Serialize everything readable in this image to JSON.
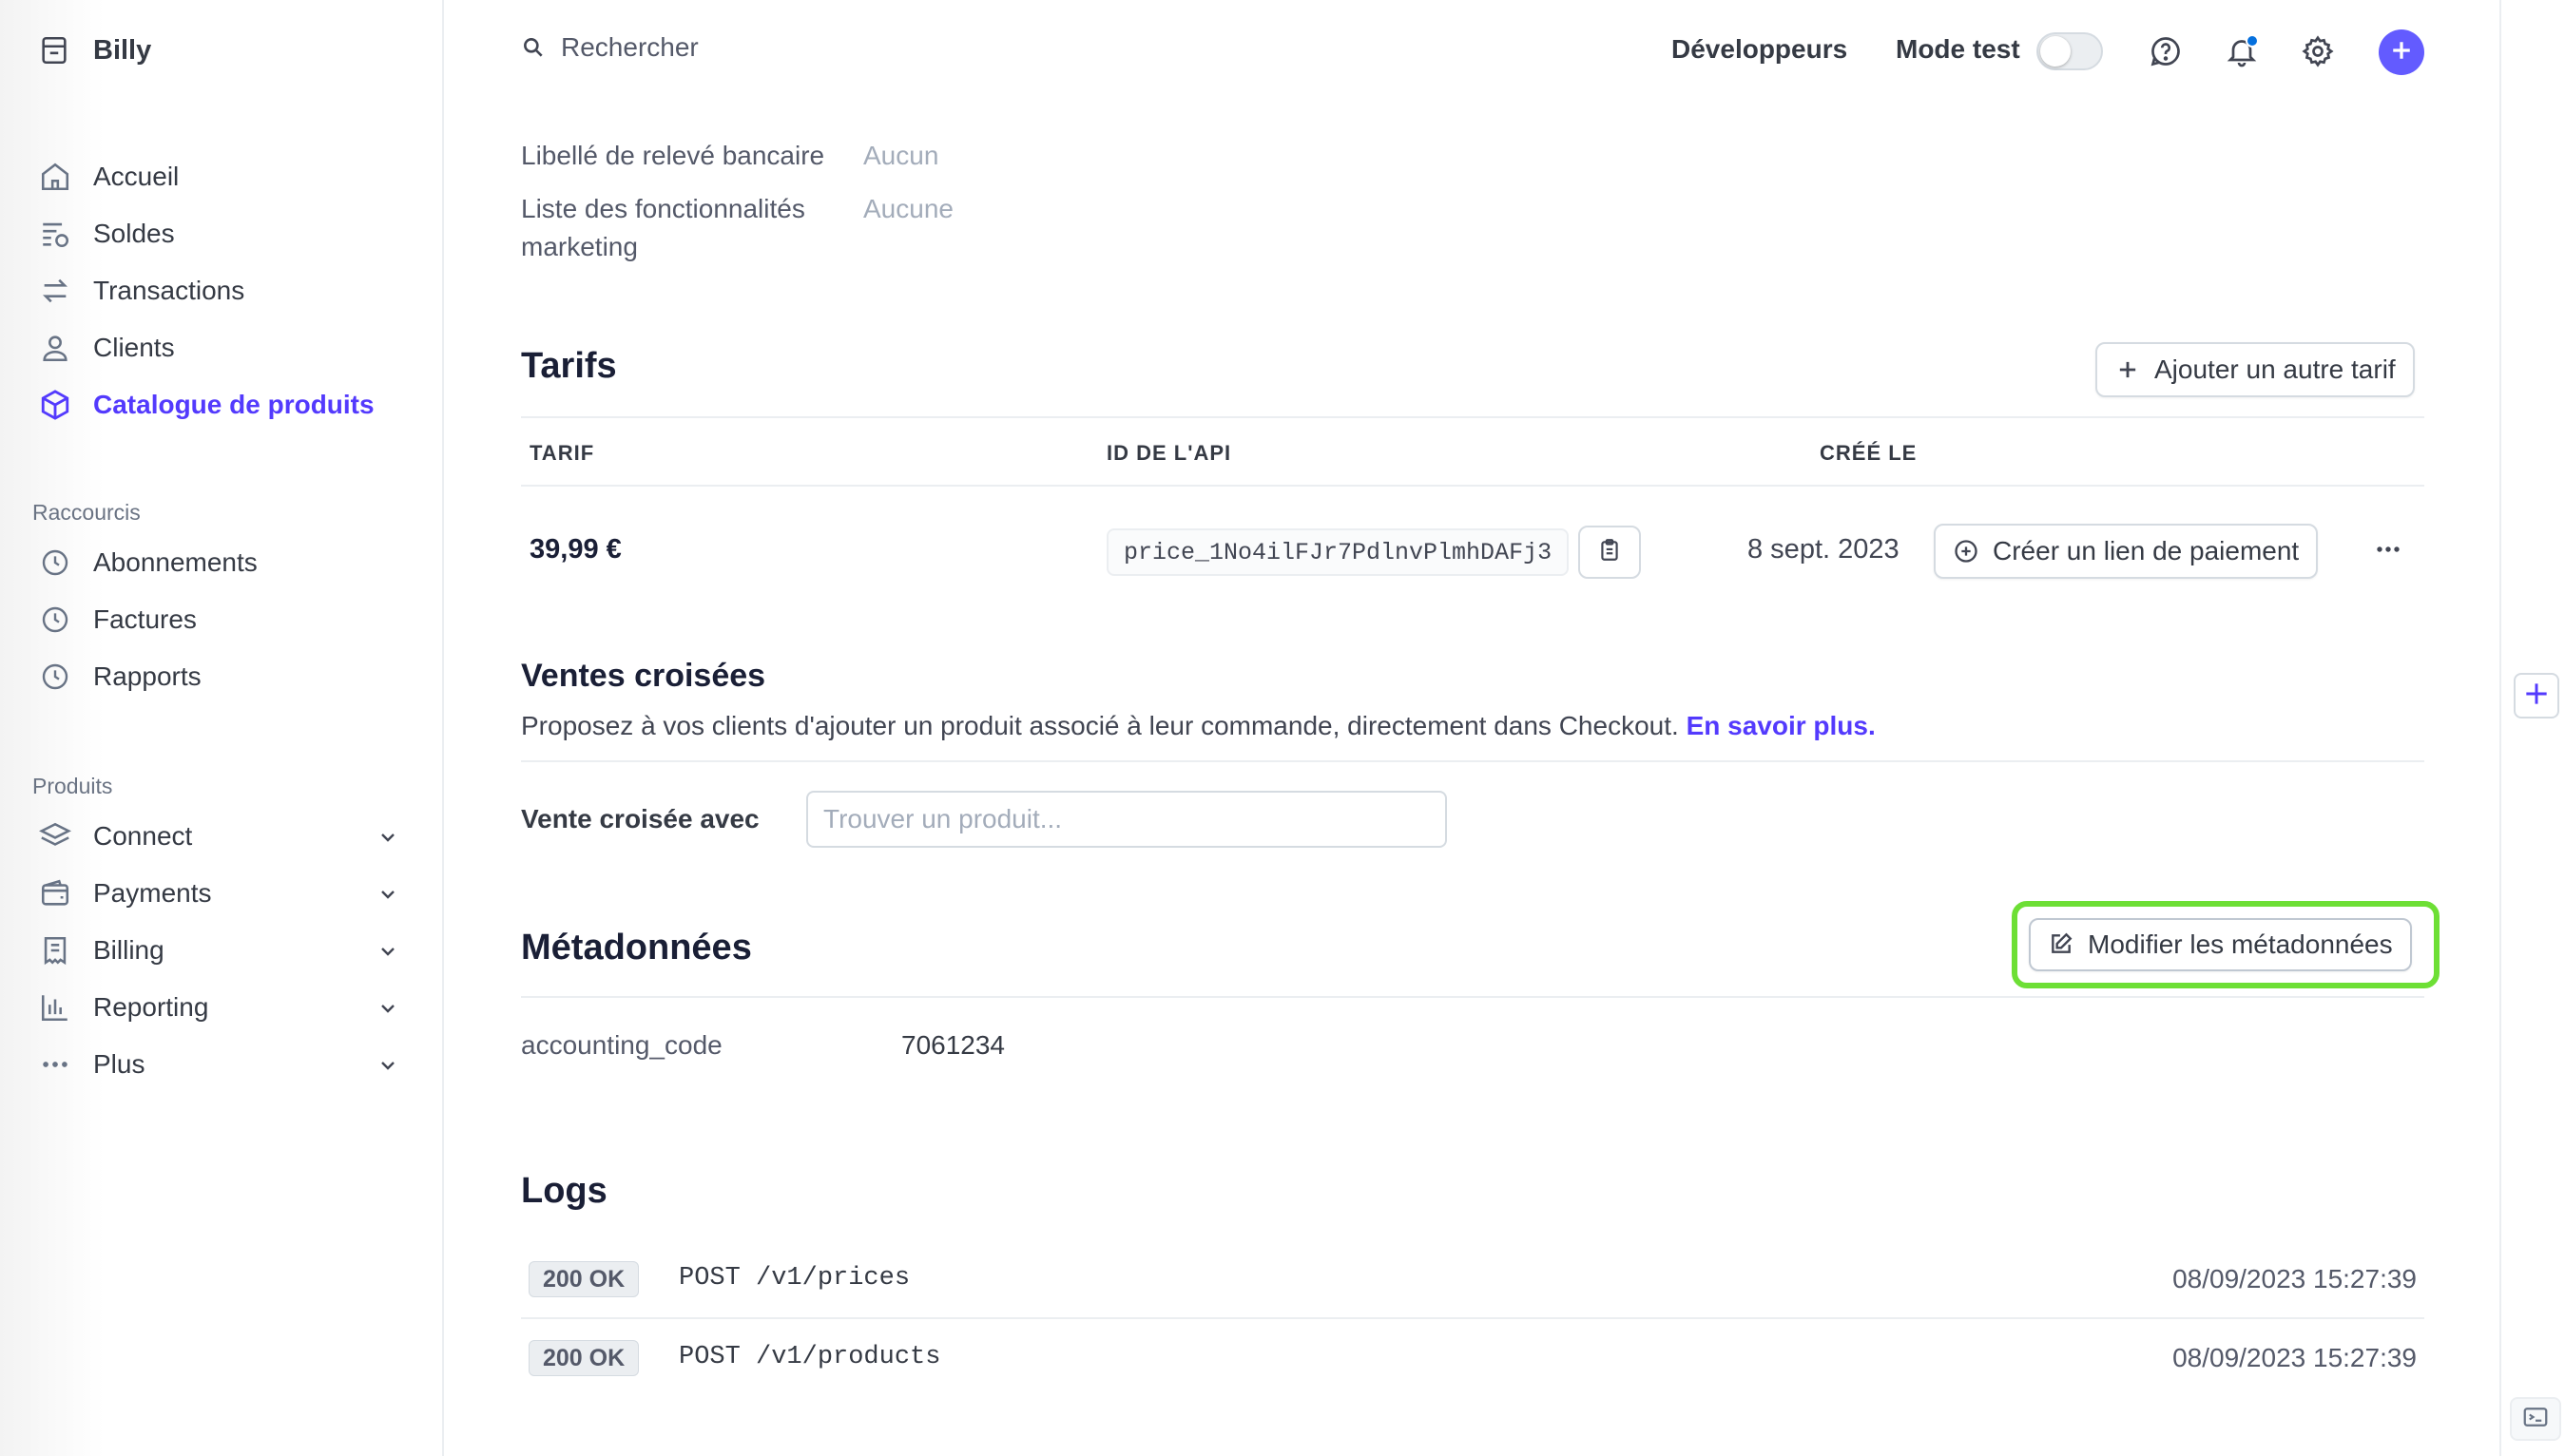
{
  "sidebar": {
    "account_name": "Billy",
    "main_items": [
      {
        "label": "Accueil",
        "icon": "home-icon"
      },
      {
        "label": "Soldes",
        "icon": "balances-icon"
      },
      {
        "label": "Transactions",
        "icon": "transactions-icon"
      },
      {
        "label": "Clients",
        "icon": "user-icon"
      },
      {
        "label": "Catalogue de produits",
        "icon": "box-icon",
        "active": true
      }
    ],
    "shortcuts_title": "Raccourcis",
    "shortcuts": [
      {
        "label": "Abonnements",
        "icon": "clock-icon"
      },
      {
        "label": "Factures",
        "icon": "clock-icon"
      },
      {
        "label": "Rapports",
        "icon": "clock-icon"
      }
    ],
    "products_title": "Produits",
    "products": [
      {
        "label": "Connect",
        "icon": "layers-icon"
      },
      {
        "label": "Payments",
        "icon": "wallet-icon"
      },
      {
        "label": "Billing",
        "icon": "invoice-icon"
      },
      {
        "label": "Reporting",
        "icon": "bar-chart-icon"
      },
      {
        "label": "Plus",
        "icon": "ellipsis-icon"
      }
    ]
  },
  "topbar": {
    "search_placeholder": "Rechercher",
    "developers_label": "Développeurs",
    "test_mode_label": "Mode test",
    "test_mode_on": false
  },
  "details": {
    "rows": [
      {
        "label": "Libellé de relevé bancaire",
        "value": "Aucun"
      },
      {
        "label_line1": "Liste des fonctionnalités",
        "label_line2": "marketing",
        "value": "Aucune"
      }
    ]
  },
  "tarifs": {
    "title": "Tarifs",
    "add_button": "Ajouter un autre tarif",
    "columns": [
      "TARIF",
      "ID DE L'API",
      "CRÉÉ LE"
    ],
    "rows": [
      {
        "price": "39,99 €",
        "api_id": "price_1No4ilFJr7PdlnvPlmhDAFj3",
        "created": "8 sept. 2023",
        "action": "Créer un lien de paiement"
      }
    ]
  },
  "cross_sell": {
    "title": "Ventes croisées",
    "description": "Proposez à vos clients d'ajouter un produit associé à leur commande, directement dans Checkout.",
    "learn_more": "En savoir plus.",
    "field_label": "Vente croisée avec",
    "field_placeholder": "Trouver un produit..."
  },
  "metadata": {
    "title": "Métadonnées",
    "edit_button": "Modifier les métadonnées",
    "highlight_color": "#6ddf35",
    "entries": [
      {
        "key": "accounting_code",
        "value": "7061234"
      }
    ]
  },
  "logs": {
    "title": "Logs",
    "entries": [
      {
        "status": "200 OK",
        "request": "POST /v1/prices",
        "time": "08/09/2023 15:27:39"
      },
      {
        "status": "200 OK",
        "request": "POST /v1/products",
        "time": "08/09/2023 15:27:39"
      }
    ]
  },
  "colors": {
    "accent": "#533afd",
    "create_button": "#635bff",
    "notification_dot": "#0570de"
  }
}
